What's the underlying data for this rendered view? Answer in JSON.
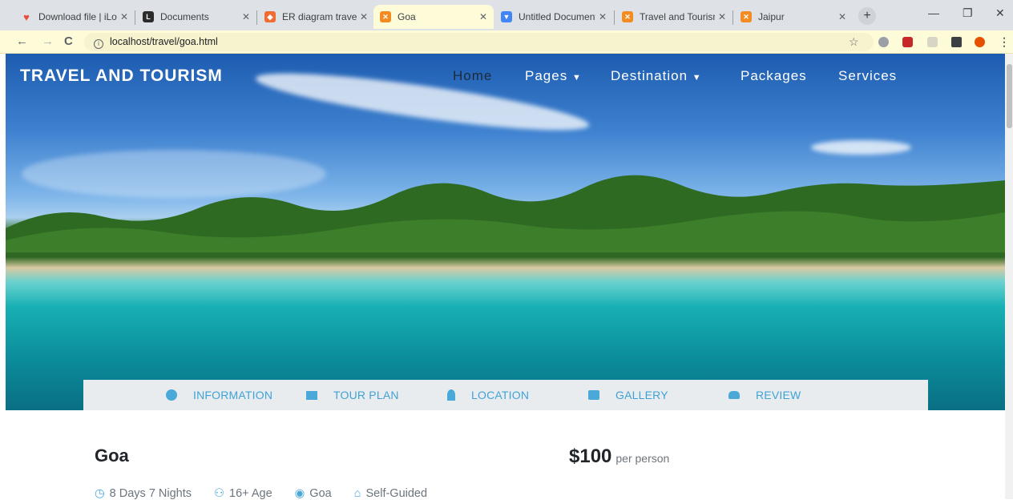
{
  "browser": {
    "tabs": [
      {
        "label": "Download file | iLo",
        "icon_color": "#e74c3c"
      },
      {
        "label": "Documents",
        "icon_color": "#2b2b2b"
      },
      {
        "label": "ER diagram travel",
        "icon_color": "#ef6c33"
      },
      {
        "label": "Goa",
        "icon_color": "#f28c22",
        "active": true
      },
      {
        "label": "Untitled Document",
        "icon_color": "#4285f4"
      },
      {
        "label": "Travel and Tourism",
        "icon_color": "#f28c22"
      },
      {
        "label": "Jaipur",
        "icon_color": "#f28c22"
      }
    ],
    "url": "localhost/travel/goa.html"
  },
  "site": {
    "brand": "TRAVEL AND TOURISM",
    "nav": {
      "home": "Home",
      "pages": "Pages",
      "destination": "Destination",
      "packages": "Packages",
      "services": "Services"
    }
  },
  "detail_tabs": {
    "information": "INFORMATION",
    "tour_plan": "TOUR PLAN",
    "location": "LOCATION",
    "gallery": "GALLERY",
    "review": "REVIEW"
  },
  "tour": {
    "title": "Goa",
    "price": "$100",
    "price_unit": "per person",
    "duration": "8 Days 7 Nights",
    "age": "16+ Age",
    "place": "Goa",
    "type": "Self-Guided"
  },
  "colors": {
    "accent": "#3fa2d6",
    "active_tab": "#fefbd8"
  }
}
